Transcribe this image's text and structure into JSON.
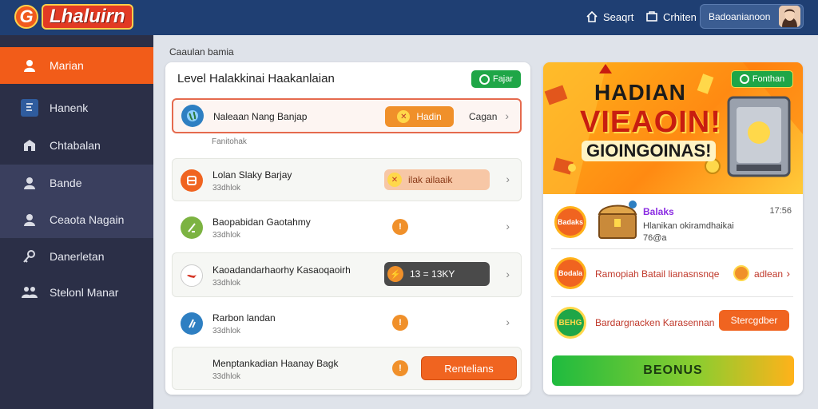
{
  "app": {
    "logo_text": "Lhaluirn",
    "logo_mark": "G"
  },
  "topbar": {
    "search_label": "Seaqrt",
    "cart_label": "Crhiten",
    "user_name": "Badoanianoon"
  },
  "sidebar": {
    "items": [
      {
        "label": "Marian",
        "icon": "user-icon",
        "active": true
      },
      {
        "label": "Hanenk",
        "icon": "document-icon"
      },
      {
        "label": "Chtabalan",
        "icon": "shop-icon"
      },
      {
        "label": "Bande",
        "icon": "person-icon"
      },
      {
        "label": "Ceaota Nagain",
        "icon": "person-icon"
      },
      {
        "label": "Danerletan",
        "icon": "key-icon"
      },
      {
        "label": "Stelonl Manar",
        "icon": "group-icon"
      }
    ]
  },
  "main": {
    "breadcrumb": "Caaulan bamia",
    "card_title": "Level Halakkinai Haakanlaian",
    "status_label": "Fajar",
    "rows": [
      {
        "name": "Naleaan Nang Banjap",
        "pill_label": "Hadin",
        "side_label": "Cagan",
        "chevron": "›"
      },
      {
        "name": "Lolan Slaky Barjay",
        "sub": "33dhlok",
        "pill_label": "ilak ailaaik",
        "chevron": "›"
      },
      {
        "name": "Baopabidan Gaotahmy",
        "sub": "33dhlok",
        "chevron": "›"
      },
      {
        "name": "Kaoadandarhaorhy Kasaoqaoirh",
        "sub": "33dhlok",
        "pill_label": "13 = 13KY",
        "chevron": "›"
      },
      {
        "name": "Rarbon landan",
        "sub": "33dhlok",
        "chevron": "›"
      },
      {
        "name": "Menptankadian Haanay Bagk",
        "sub": "33dhlok",
        "action_label": "Rentelians"
      }
    ],
    "sub_below_first": "Fanitohak"
  },
  "promo": {
    "banner_line1": "HADIAN",
    "banner_line2": "VIEAOIN!",
    "banner_line3": "GIOINGOINAS!",
    "banner_pill": "Fonthan",
    "items": [
      {
        "badge": "Badaks",
        "title": "Balaks",
        "desc": "Hlanikan okiramdhaikai",
        "desc2": "76@a",
        "time": "17:56"
      },
      {
        "badge": "Bodala",
        "title": "Ramopiah Batail lianasnsnqe",
        "link": "adlean"
      },
      {
        "badge": "BEHG",
        "title": "Bardargnacken Karasennan",
        "button": "Stercgdber"
      }
    ],
    "bonus_button": "BEONUS"
  },
  "colors": {
    "accent": "#f25c19",
    "topbar": "#1f3f73",
    "sidebar": "#2b2f47",
    "success": "#1fa647"
  }
}
